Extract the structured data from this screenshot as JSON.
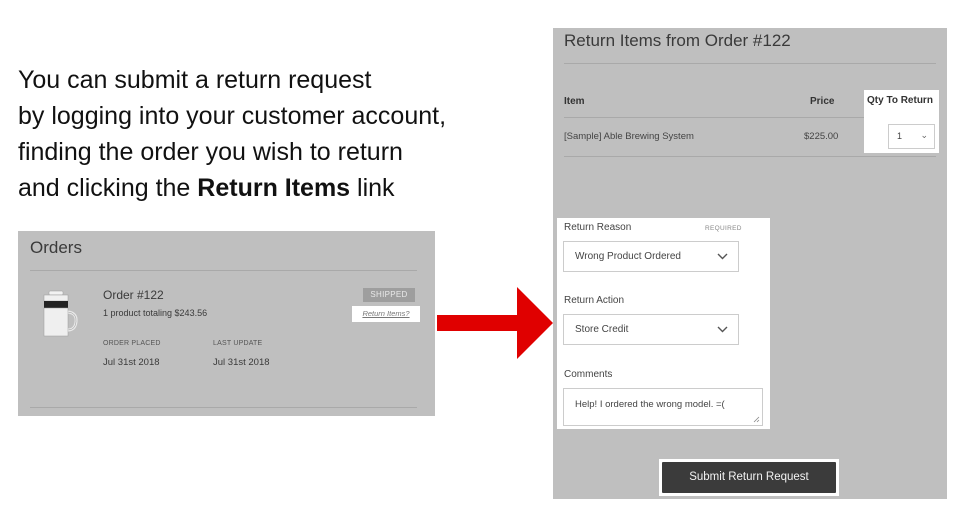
{
  "intro": {
    "line1": "You can submit a return request",
    "line2": "by logging into your customer account,",
    "line3": "finding the order you wish to return",
    "line4_pre": "and clicking the ",
    "line4_bold": "Return Items",
    "line4_post": " link"
  },
  "orders": {
    "title": "Orders",
    "order_number": "Order #122",
    "order_total": "1 product totaling $243.56",
    "status": "SHIPPED",
    "return_link": "Return Items?",
    "placed_label": "ORDER PLACED",
    "placed_value": "Jul 31st 2018",
    "update_label": "LAST UPDATE",
    "update_value": "Jul 31st 2018"
  },
  "return_form": {
    "title": "Return Items from Order #122",
    "col_item": "Item",
    "col_price": "Price",
    "col_qty": "Qty To Return",
    "row_item": "[Sample] Able Brewing System",
    "row_price": "$225.00",
    "row_qty": "1",
    "reason_label": "Return Reason",
    "reason_required": "REQUIRED",
    "reason_value": "Wrong Product Ordered",
    "action_label": "Return Action",
    "action_value": "Store Credit",
    "comments_label": "Comments",
    "comments_value": "Help! I ordered the wrong model.  =(",
    "submit_label": "Submit Return Request"
  },
  "colors": {
    "panel_bg": "#bfbfbf",
    "arrow": "#e00000",
    "button_bg": "#3b3b3b",
    "highlight": "#ffffff"
  },
  "icons": [
    "chevron-down-icon",
    "arrow-right-icon",
    "coffee-brewer-image",
    "resize-grip-icon"
  ]
}
